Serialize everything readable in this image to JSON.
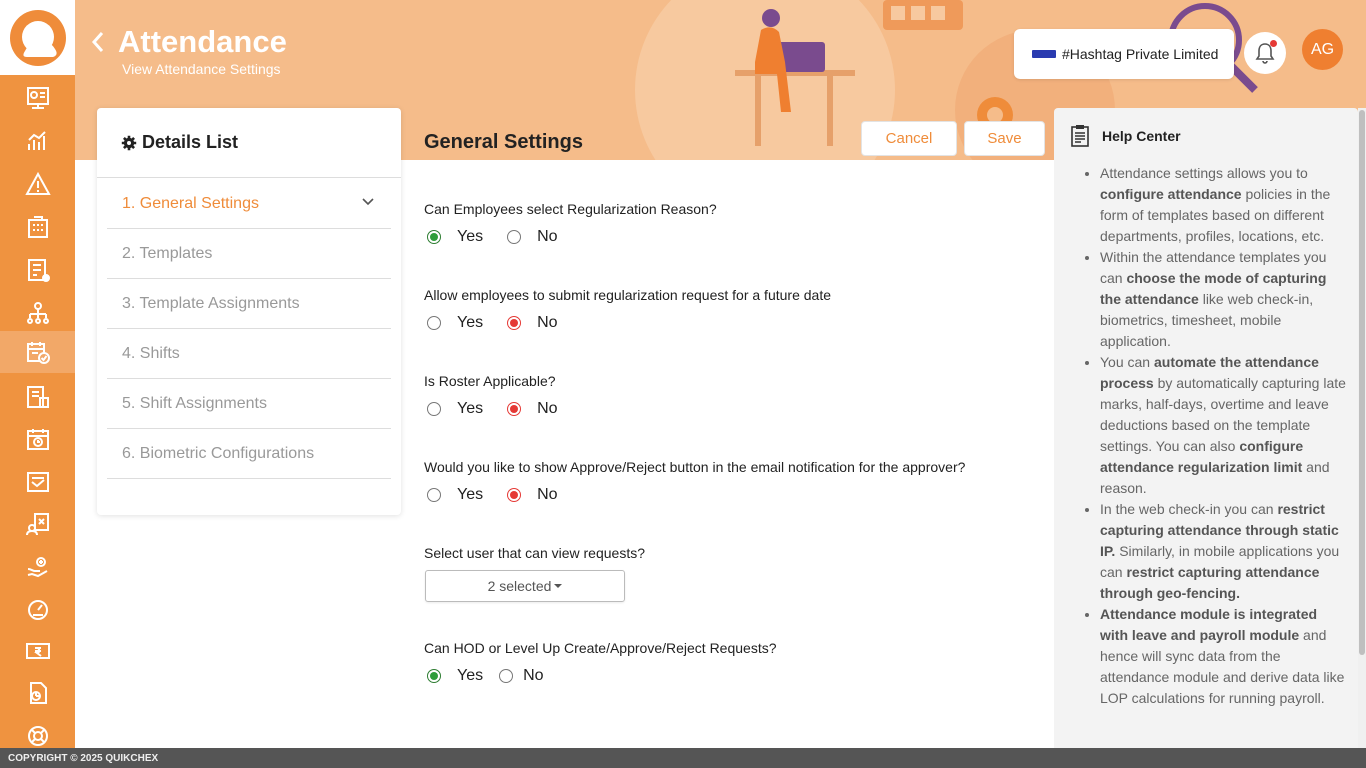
{
  "header": {
    "title": "Attendance",
    "subtitle": "View Attendance Settings",
    "company": "#Hashtag Private Limited",
    "avatar_initials": "AG"
  },
  "sidebar": {
    "icons": [
      "dashboard-icon",
      "analytics-icon",
      "alert-icon",
      "building-icon",
      "tax-icon",
      "org-chart-icon",
      "attendance-icon",
      "reports-icon",
      "calendar-clock-icon",
      "certificate-icon",
      "expense-icon",
      "helpdesk-icon",
      "performance-icon",
      "payroll-icon",
      "documents-icon",
      "support-icon"
    ],
    "active_index": 6
  },
  "details": {
    "heading": "Details List",
    "items": [
      {
        "label": "1. General Settings"
      },
      {
        "label": "2. Templates"
      },
      {
        "label": "3. Template Assignments"
      },
      {
        "label": "4. Shifts"
      },
      {
        "label": "5. Shift Assignments"
      },
      {
        "label": "6. Biometric Configurations"
      }
    ]
  },
  "general": {
    "title": "General Settings",
    "cancel_label": "Cancel",
    "save_label": "Save",
    "questions": [
      {
        "text": "Can Employees select Regularization Reason?",
        "yes": "Yes",
        "no": "No",
        "selected": "yes"
      },
      {
        "text": "Allow employees to submit regularization request for a future date",
        "yes": "Yes",
        "no": "No",
        "selected": "no"
      },
      {
        "text": "Is Roster Applicable?",
        "yes": "Yes",
        "no": "No",
        "selected": "no"
      },
      {
        "text": "Would you like to show Approve/Reject button in the email notification for the approver?",
        "yes": "Yes",
        "no": "No",
        "selected": "no"
      },
      {
        "text": "Can HOD or Level Up Create/Approve/Reject Requests?",
        "yes": "Yes",
        "no": "No",
        "selected": "yes"
      }
    ],
    "select_question": "Select user that can view requests?",
    "select_value": "2 selected"
  },
  "help": {
    "title": "Help Center"
  },
  "footer": {
    "copyright": "COPYRIGHT © 2025 QUIKCHEX"
  },
  "colors": {
    "sidebar": "#ef9340",
    "accent": "#ef8c3a",
    "banner": "#f5bc8a",
    "yes_selected": "#2e9d3a",
    "no_selected": "#e53935"
  }
}
